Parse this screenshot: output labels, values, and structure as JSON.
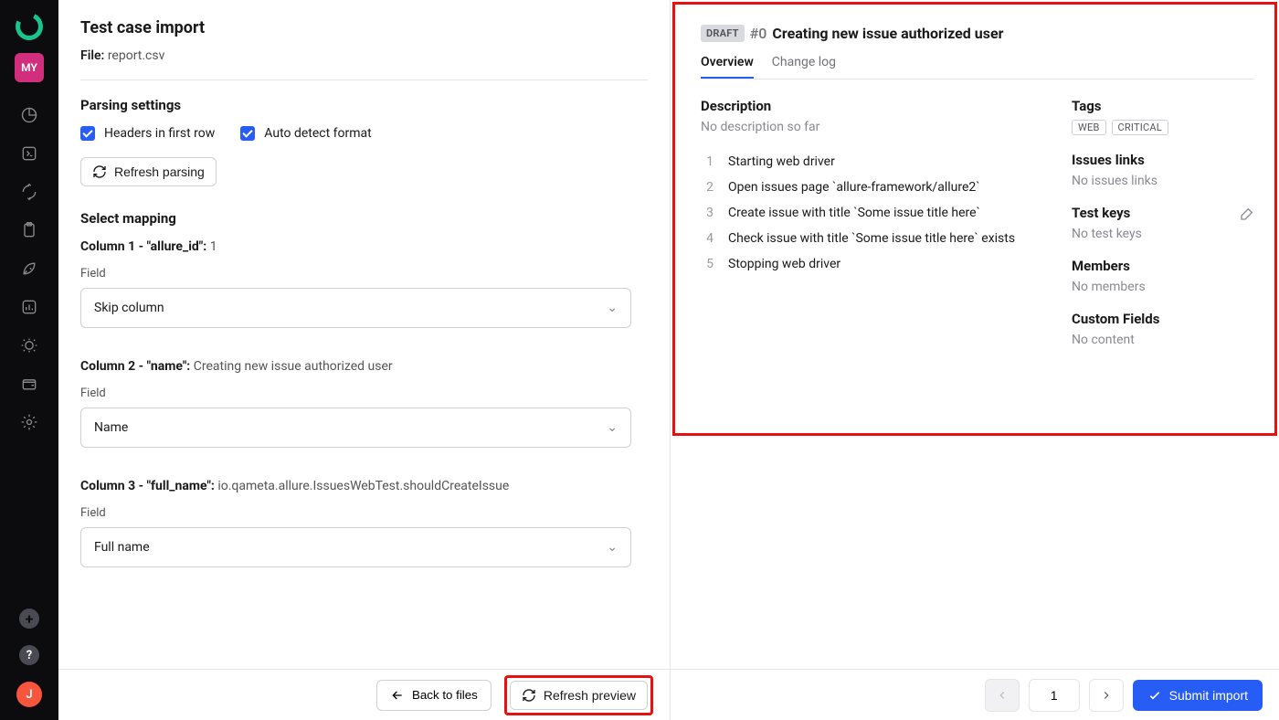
{
  "sidebar": {
    "my_badge": "MY",
    "avatar_initial": "J"
  },
  "import": {
    "page_title": "Test case import",
    "file_label": "File:",
    "file_name": "report.csv",
    "parsing_title": "Parsing settings",
    "opt_headers": "Headers in first row",
    "opt_autodetect": "Auto detect format",
    "refresh_parsing": "Refresh parsing",
    "mapping_title": "Select mapping",
    "field_label": "Field",
    "columns": [
      {
        "header_prefix": "Column 1 - \"allure_id\":",
        "header_value": "1",
        "field_value": "Skip column"
      },
      {
        "header_prefix": "Column 2 - \"name\":",
        "header_value": "Creating new issue authorized user",
        "field_value": "Name"
      },
      {
        "header_prefix": "Column 3 - \"full_name\":",
        "header_value": "io.qameta.allure.IssuesWebTest.shouldCreateIssue",
        "field_value": "Full name"
      }
    ],
    "back_to_files": "Back to files",
    "refresh_preview": "Refresh preview"
  },
  "preview": {
    "draft_badge": "DRAFT",
    "tc_id": "#0",
    "tc_title": "Creating new issue authorized user",
    "tabs": {
      "overview": "Overview",
      "change_log": "Change log"
    },
    "description_title": "Description",
    "description_empty": "No description so far",
    "steps": [
      "Starting web driver",
      "Open issues page `allure-framework/allure2`",
      "Create issue with title `Some issue title here`",
      "Check issue with title `Some issue title here` exists",
      "Stopping web driver"
    ],
    "tags_title": "Tags",
    "tags": [
      "WEB",
      "CRITICAL"
    ],
    "issues_links_title": "Issues links",
    "issues_links_empty": "No issues links",
    "test_keys_title": "Test keys",
    "test_keys_empty": "No test keys",
    "members_title": "Members",
    "members_empty": "No members",
    "custom_fields_title": "Custom Fields",
    "custom_fields_empty": "No content"
  },
  "footer_right": {
    "page": "1",
    "submit": "Submit import"
  }
}
